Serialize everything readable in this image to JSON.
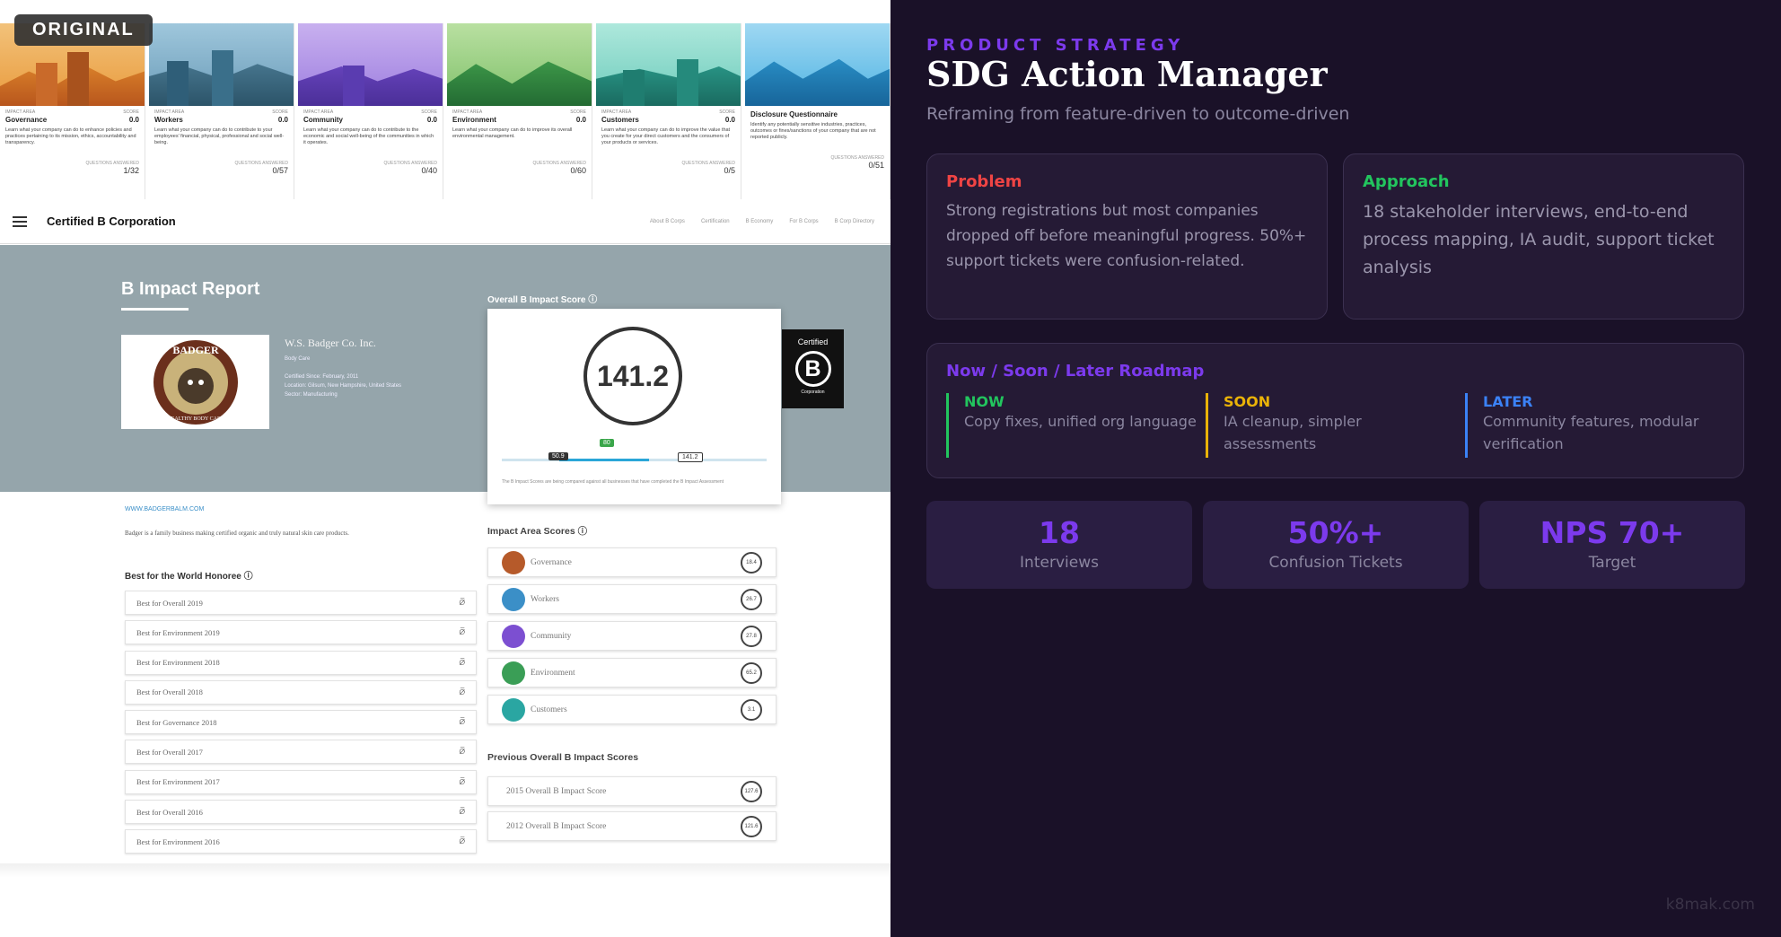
{
  "original_panel": {
    "badge": "ORIGINAL",
    "area_cards": [
      {
        "meta_left": "IMPACT AREA",
        "meta_right": "SCORE",
        "title": "Governance",
        "score": "0.0",
        "text": "Learn what your company can do to enhance policies and practices pertaining to its mission, ethics, accountability and transparency.",
        "qa_label": "QUESTIONS ANSWERED",
        "qa": "1/32"
      },
      {
        "meta_left": "IMPACT AREA",
        "meta_right": "SCORE",
        "title": "Workers",
        "score": "0.0",
        "text": "Learn what your company can do to contribute to your employees' financial, physical, professional and social well-being.",
        "qa_label": "QUESTIONS ANSWERED",
        "qa": "0/57"
      },
      {
        "meta_left": "IMPACT AREA",
        "meta_right": "SCORE",
        "title": "Community",
        "score": "0.0",
        "text": "Learn what your company can do to contribute to the economic and social well-being of the communities in which it operates.",
        "qa_label": "QUESTIONS ANSWERED",
        "qa": "0/40"
      },
      {
        "meta_left": "IMPACT AREA",
        "meta_right": "SCORE",
        "title": "Environment",
        "score": "0.0",
        "text": "Learn what your company can do to improve its overall environmental management.",
        "qa_label": "QUESTIONS ANSWERED",
        "qa": "0/60"
      },
      {
        "meta_left": "IMPACT AREA",
        "meta_right": "SCORE",
        "title": "Customers",
        "score": "0.0",
        "text": "Learn what your company can do to improve the value that you create for your direct customers and the consumers of your products or services.",
        "qa_label": "QUESTIONS ANSWERED",
        "qa": "0/5"
      },
      {
        "meta_left": "",
        "meta_right": "",
        "title": "Disclosure Questionnaire",
        "score": "",
        "text": "Identify any potentially sensitive industries, practices, outcomes or fines/sanctions of your company that are not reported publicly.",
        "qa_label": "QUESTIONS ANSWERED",
        "qa": "0/51"
      }
    ],
    "nav": {
      "brand": "Certified B Corporation",
      "links": [
        "About B Corps",
        "Certification",
        "B Economy",
        "For B Corps",
        "B Corp Directory"
      ]
    },
    "report": {
      "title": "B Impact Report",
      "company_name": "W.S. Badger Co. Inc.",
      "company_lines": [
        "Body Care",
        "",
        "Certified Since: February, 2011",
        "Location: Gilsum, New Hampshire, United States",
        "Sector: Manufacturing"
      ],
      "logo_text": "BADGER",
      "logo_subtext": "HEALTHY BODY CARE",
      "overall_label": "Overall B Impact Score ⓘ",
      "overall_score": "141.2",
      "bar_pills": {
        "min": "50.9",
        "marker": "80",
        "current": "141.2"
      },
      "bar_note": "The B Impact Scores are being compared against all businesses that have completed the B Impact Assessment",
      "cert_badge": {
        "top": "Certified",
        "letter": "B",
        "bottom": "Corporation"
      },
      "website": "WWW.BADGERBALM.COM",
      "blurb": "Badger is a family business making certified organic and truly natural skin care products.",
      "honoree_heading": "Best for the World Honoree ⓘ",
      "honorees": [
        "Best for Overall 2019",
        "Best for Environment 2019",
        "Best for Environment 2018",
        "Best for Overall 2018",
        "Best for Governance 2018",
        "Best for Overall 2017",
        "Best for Environment 2017",
        "Best for Overall 2016",
        "Best for Environment 2016"
      ],
      "link_icon": "⦱",
      "impact_heading": "Impact Area Scores ⓘ",
      "impact_areas": [
        {
          "name": "Governance",
          "score": "18.4",
          "color": "#b65a2a"
        },
        {
          "name": "Workers",
          "score": "26.7",
          "color": "#3b8fc7"
        },
        {
          "name": "Community",
          "score": "27.8",
          "color": "#7c4fd1"
        },
        {
          "name": "Environment",
          "score": "65.2",
          "color": "#3a9e56"
        },
        {
          "name": "Customers",
          "score": "3.1",
          "color": "#2aa6a2"
        }
      ],
      "prev_heading": "Previous Overall B Impact Scores",
      "prev_scores": [
        {
          "name": "2015 Overall B Impact Score",
          "score": "127.6"
        },
        {
          "name": "2012 Overall B Impact Score",
          "score": "121.6"
        }
      ]
    }
  },
  "strategy_panel": {
    "eyebrow": "PRODUCT STRATEGY",
    "title": "SDG Action Manager",
    "subtitle": "Reframing from feature-driven to outcome-driven",
    "problem": {
      "heading": "Problem",
      "body": "Strong registrations but most companies dropped off before meaningful progress. 50%+ support tickets were confusion-related."
    },
    "approach": {
      "heading": "Approach",
      "body": "18 stakeholder interviews, end-to-end process mapping, IA audit, support ticket analysis"
    },
    "roadmap": {
      "heading": "Now / Soon / Later Roadmap",
      "columns": [
        {
          "tag": "NOW",
          "text": "Copy fixes, unified org language",
          "color": "#22c55e"
        },
        {
          "tag": "SOON",
          "text": "IA cleanup, simpler assessments",
          "color": "#eab308"
        },
        {
          "tag": "LATER",
          "text": "Community features, modular verification",
          "color": "#3b82f6"
        }
      ]
    },
    "stats": [
      {
        "value": "18",
        "label": "Interviews"
      },
      {
        "value": "50%+",
        "label": "Confusion Tickets"
      },
      {
        "value": "NPS 70+",
        "label": "Target"
      }
    ],
    "credit": "k8mak.com"
  },
  "colors": {
    "accent": "#7c3aed",
    "problem": "#ef4444",
    "approach": "#22c55e",
    "panel_bg": "#1a1128"
  }
}
